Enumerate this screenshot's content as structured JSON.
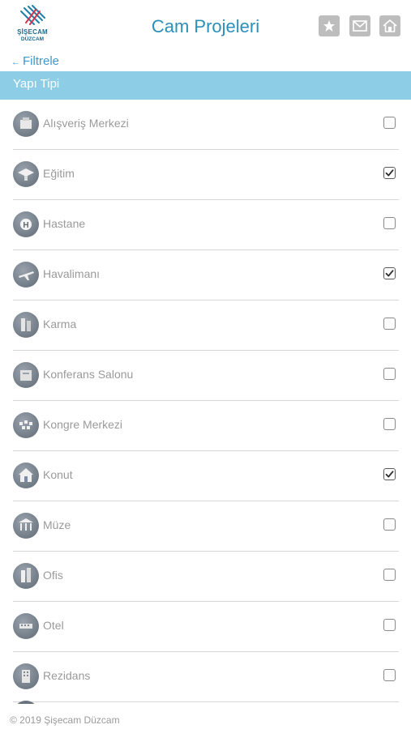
{
  "header": {
    "logo_line1": "ŞİŞECAM",
    "logo_line2": "DÜZCAM",
    "title": "Cam Projeleri",
    "icons": [
      "star-icon",
      "mail-icon",
      "home-icon"
    ]
  },
  "nav": {
    "back_arrow": "←",
    "back_label": "Filtrele"
  },
  "section": {
    "title": "Yapı Tipi"
  },
  "items": [
    {
      "label": "Alışveriş Merkezi",
      "checked": false,
      "icon": "shopping-mall-icon"
    },
    {
      "label": "Eğitim",
      "checked": true,
      "icon": "education-icon"
    },
    {
      "label": "Hastane",
      "checked": false,
      "icon": "hospital-icon"
    },
    {
      "label": "Havalimanı",
      "checked": true,
      "icon": "airport-icon"
    },
    {
      "label": "Karma",
      "checked": false,
      "icon": "mixed-use-icon"
    },
    {
      "label": "Konferans Salonu",
      "checked": false,
      "icon": "conference-hall-icon"
    },
    {
      "label": "Kongre Merkezi",
      "checked": false,
      "icon": "congress-center-icon"
    },
    {
      "label": "Konut",
      "checked": true,
      "icon": "residence-icon"
    },
    {
      "label": "Müze",
      "checked": false,
      "icon": "museum-icon"
    },
    {
      "label": "Ofis",
      "checked": false,
      "icon": "office-icon"
    },
    {
      "label": "Otel",
      "checked": false,
      "icon": "hotel-icon"
    },
    {
      "label": "Rezidans",
      "checked": false,
      "icon": "residence-tower-icon"
    }
  ],
  "footer": {
    "copyright": "© 2019 Şişecam Düzcam"
  },
  "colors": {
    "accent": "#2b8fb8",
    "section_bar": "#8ecde6",
    "button_gray": "#bdbdbd",
    "label_gray": "#9a9a9a"
  }
}
